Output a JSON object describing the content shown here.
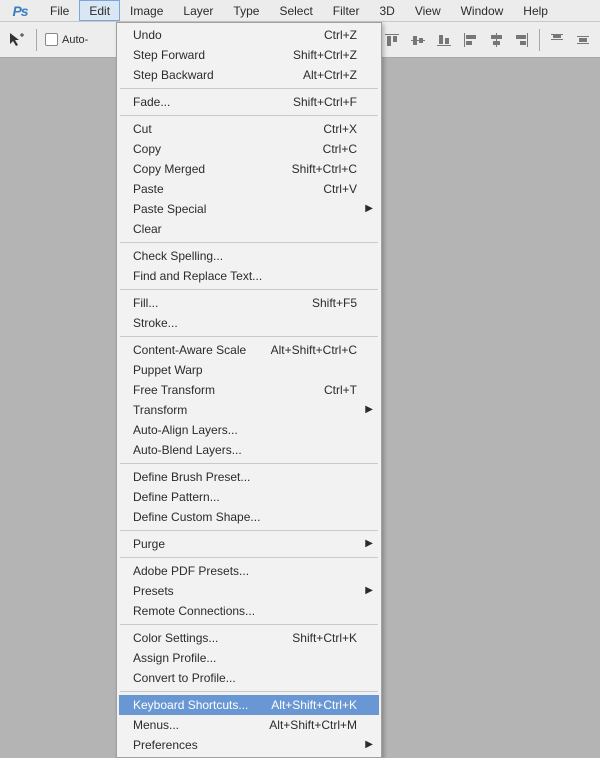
{
  "app": {
    "logo": "Ps"
  },
  "menubar": {
    "items": [
      {
        "label": "File"
      },
      {
        "label": "Edit",
        "active": true
      },
      {
        "label": "Image"
      },
      {
        "label": "Layer"
      },
      {
        "label": "Type"
      },
      {
        "label": "Select"
      },
      {
        "label": "Filter"
      },
      {
        "label": "3D"
      },
      {
        "label": "View"
      },
      {
        "label": "Window"
      },
      {
        "label": "Help"
      }
    ]
  },
  "toolbar": {
    "auto_select_label": "Auto-",
    "auto_select_checked": false
  },
  "edit_menu": {
    "groups": [
      [
        {
          "label": "Undo",
          "shortcut": "Ctrl+Z"
        },
        {
          "label": "Step Forward",
          "shortcut": "Shift+Ctrl+Z"
        },
        {
          "label": "Step Backward",
          "shortcut": "Alt+Ctrl+Z"
        }
      ],
      [
        {
          "label": "Fade...",
          "shortcut": "Shift+Ctrl+F"
        }
      ],
      [
        {
          "label": "Cut",
          "shortcut": "Ctrl+X"
        },
        {
          "label": "Copy",
          "shortcut": "Ctrl+C"
        },
        {
          "label": "Copy Merged",
          "shortcut": "Shift+Ctrl+C"
        },
        {
          "label": "Paste",
          "shortcut": "Ctrl+V"
        },
        {
          "label": "Paste Special",
          "submenu": true
        },
        {
          "label": "Clear"
        }
      ],
      [
        {
          "label": "Check Spelling..."
        },
        {
          "label": "Find and Replace Text..."
        }
      ],
      [
        {
          "label": "Fill...",
          "shortcut": "Shift+F5"
        },
        {
          "label": "Stroke..."
        }
      ],
      [
        {
          "label": "Content-Aware Scale",
          "shortcut": "Alt+Shift+Ctrl+C"
        },
        {
          "label": "Puppet Warp"
        },
        {
          "label": "Free Transform",
          "shortcut": "Ctrl+T"
        },
        {
          "label": "Transform",
          "submenu": true
        },
        {
          "label": "Auto-Align Layers..."
        },
        {
          "label": "Auto-Blend Layers..."
        }
      ],
      [
        {
          "label": "Define Brush Preset..."
        },
        {
          "label": "Define Pattern..."
        },
        {
          "label": "Define Custom Shape..."
        }
      ],
      [
        {
          "label": "Purge",
          "submenu": true
        }
      ],
      [
        {
          "label": "Adobe PDF Presets..."
        },
        {
          "label": "Presets",
          "submenu": true
        },
        {
          "label": "Remote Connections..."
        }
      ],
      [
        {
          "label": "Color Settings...",
          "shortcut": "Shift+Ctrl+K"
        },
        {
          "label": "Assign Profile..."
        },
        {
          "label": "Convert to Profile..."
        }
      ],
      [
        {
          "label": "Keyboard Shortcuts...",
          "shortcut": "Alt+Shift+Ctrl+K",
          "highlighted": true
        },
        {
          "label": "Menus...",
          "shortcut": "Alt+Shift+Ctrl+M"
        },
        {
          "label": "Preferences",
          "submenu": true
        }
      ]
    ]
  }
}
